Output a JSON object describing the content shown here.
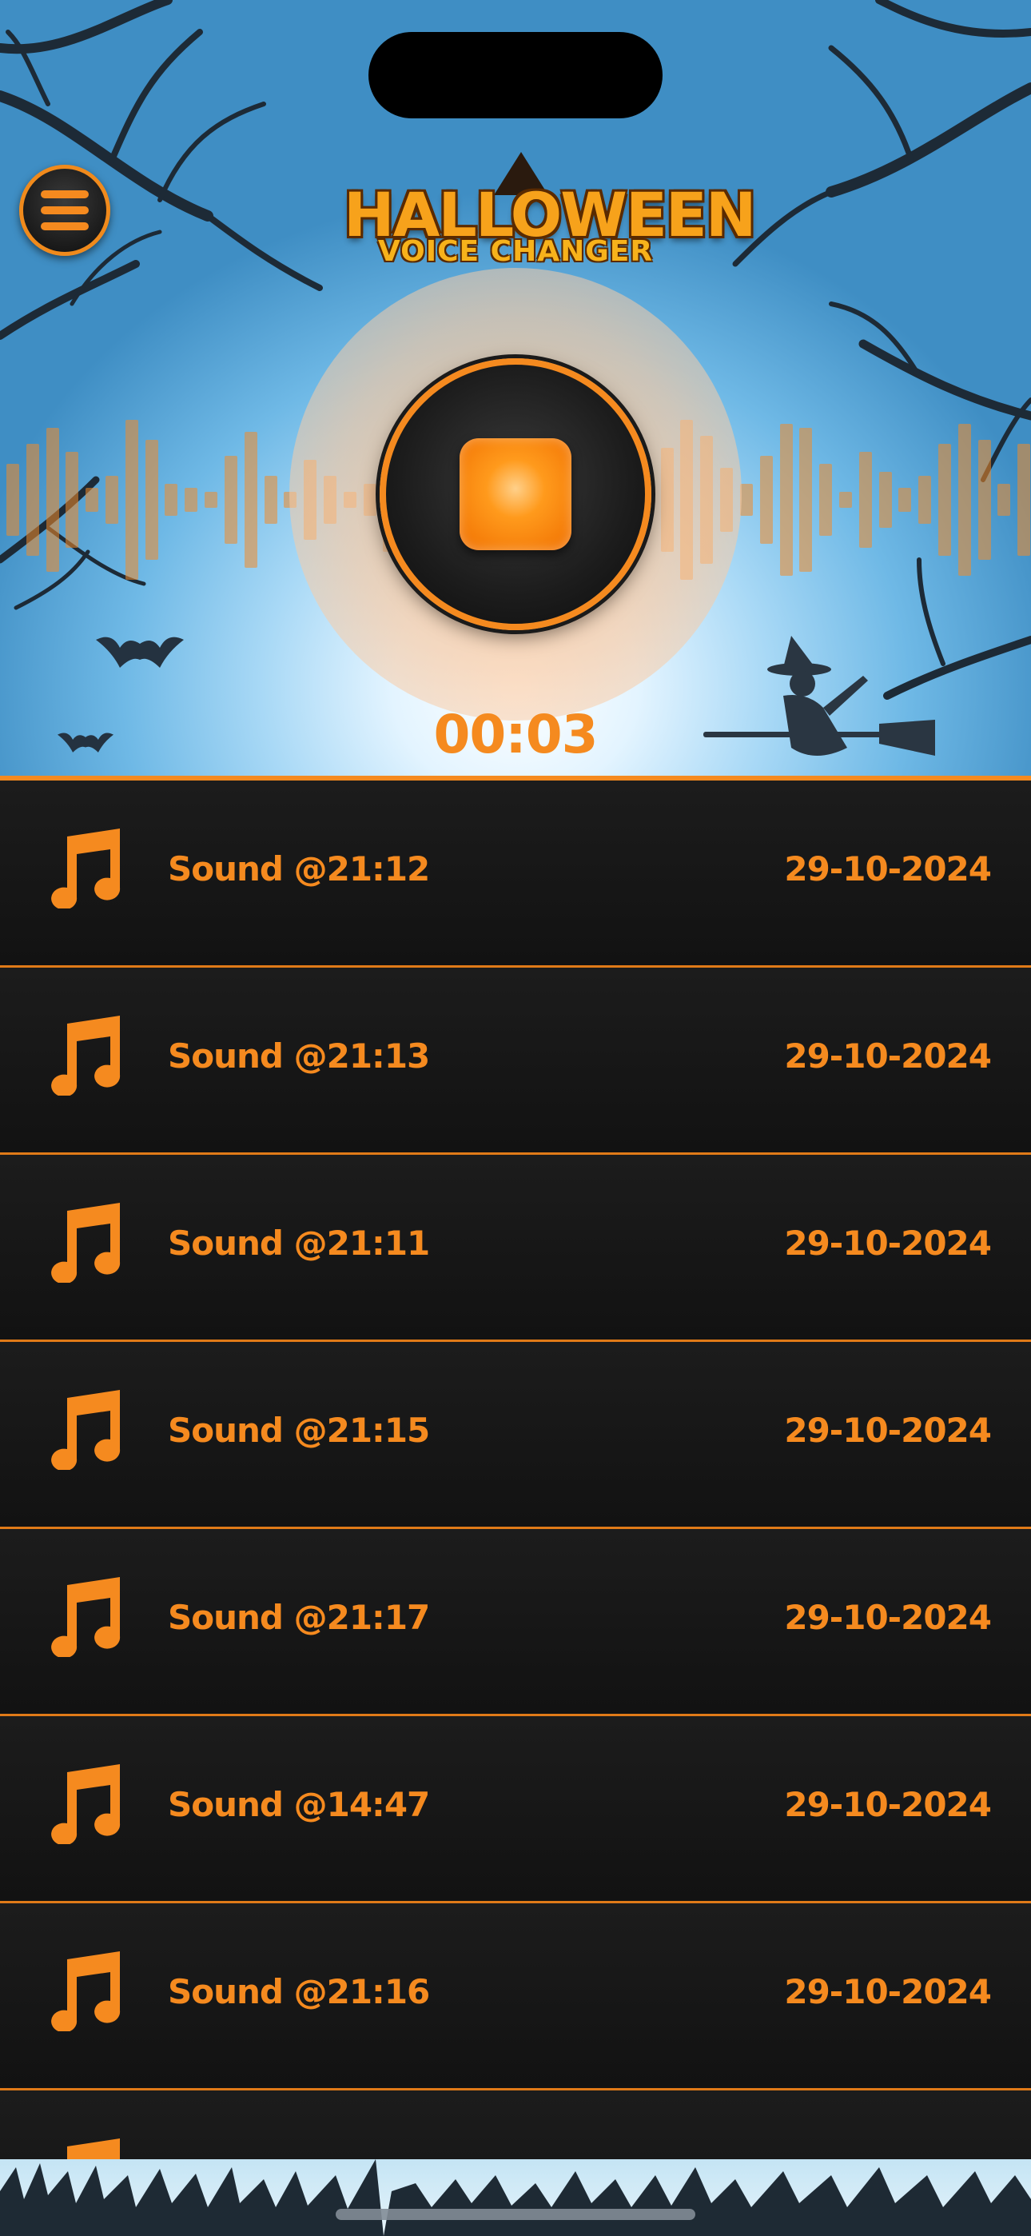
{
  "app": {
    "logo_title": "HALLOWEEN",
    "logo_subtitle": "VOICE CHANGER"
  },
  "recorder": {
    "timer": "00:03",
    "state": "recording"
  },
  "recordings": [
    {
      "name": "Sound @21:12",
      "date": "29-10-2024"
    },
    {
      "name": "Sound @21:13",
      "date": "29-10-2024"
    },
    {
      "name": "Sound @21:11",
      "date": "29-10-2024"
    },
    {
      "name": "Sound @21:15",
      "date": "29-10-2024"
    },
    {
      "name": "Sound @21:17",
      "date": "29-10-2024"
    },
    {
      "name": "Sound @14:47",
      "date": "29-10-2024"
    },
    {
      "name": "Sound @21:16",
      "date": "29-10-2024"
    },
    {
      "name": "",
      "date": ""
    }
  ],
  "icons": {
    "menu": "hamburger-menu-icon",
    "record": "stop-icon",
    "recording_item": "music-note-icon"
  },
  "colors": {
    "accent": "#f58a1f",
    "list_background": "#141414",
    "sky": "#6fb9e6"
  }
}
